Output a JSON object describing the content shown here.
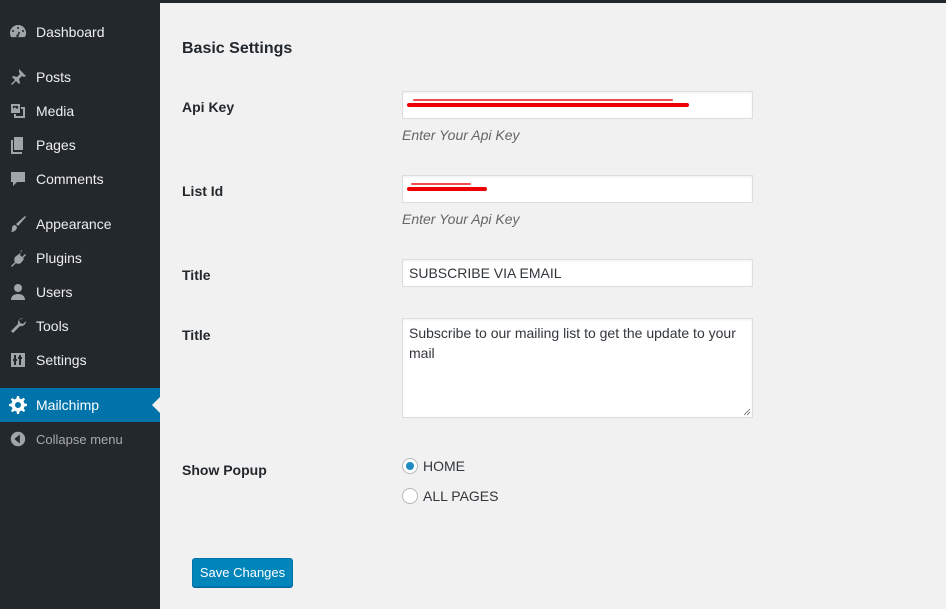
{
  "sidebar": {
    "items": [
      {
        "label": "Dashboard",
        "icon": "dashboard-icon"
      },
      {
        "label": "Posts",
        "icon": "pin-icon"
      },
      {
        "label": "Media",
        "icon": "media-icon"
      },
      {
        "label": "Pages",
        "icon": "pages-icon"
      },
      {
        "label": "Comments",
        "icon": "comment-icon"
      },
      {
        "label": "Appearance",
        "icon": "brush-icon"
      },
      {
        "label": "Plugins",
        "icon": "plug-icon"
      },
      {
        "label": "Users",
        "icon": "user-icon"
      },
      {
        "label": "Tools",
        "icon": "wrench-icon"
      },
      {
        "label": "Settings",
        "icon": "settings-sliders-icon"
      },
      {
        "label": "Mailchimp",
        "icon": "gear-icon",
        "active": true
      },
      {
        "label": "Collapse menu",
        "icon": "collapse-arrow-icon"
      }
    ],
    "active_color": "#0073aa"
  },
  "main": {
    "heading": "Basic Settings",
    "api_key": {
      "label": "Api Key",
      "hint": "Enter Your Api Key"
    },
    "list_id": {
      "label": "List Id",
      "hint": "Enter Your Api Key"
    },
    "title": {
      "label": "Title",
      "value": "SUBSCRIBE VIA EMAIL"
    },
    "description": {
      "label": "Title",
      "value": "Subscribe to our mailing list to get the update to your mail"
    },
    "show_popup": {
      "label": "Show Popup",
      "options": [
        {
          "label": "HOME",
          "checked": true
        },
        {
          "label": "ALL PAGES",
          "checked": false
        }
      ]
    },
    "save_label": "Save Changes"
  }
}
